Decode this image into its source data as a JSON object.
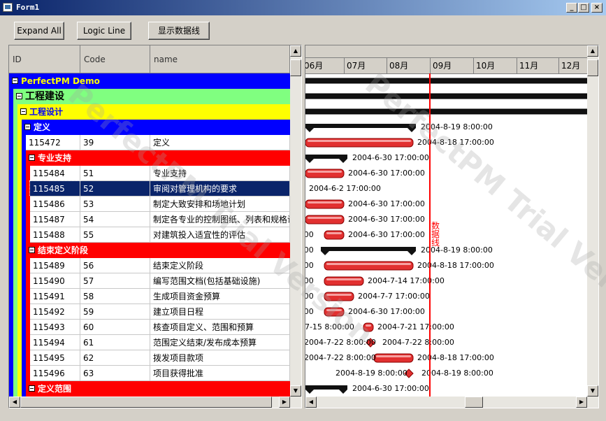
{
  "window": {
    "title": "Form1"
  },
  "toolbar": {
    "expand_all": "Expand All",
    "logic_line": "Logic Line",
    "show_data_line": "显示数据线"
  },
  "grid": {
    "headers": {
      "id": "ID",
      "code": "Code",
      "name": "name"
    },
    "rows": [
      {
        "type": "group",
        "level": 0,
        "label": "PerfectPM Demo",
        "bg": "#0000ff",
        "fg": "#ffff00"
      },
      {
        "type": "group",
        "level": 1,
        "label": "工程建设",
        "bg": "#80ff80",
        "fg": "#000000"
      },
      {
        "type": "group",
        "level": 2,
        "label": "工程设计",
        "bg": "#ffff00",
        "fg": "#0000ff"
      },
      {
        "type": "group",
        "level": 3,
        "label": "定义",
        "bg": "#0000ff",
        "fg": "#ffffff"
      },
      {
        "type": "task",
        "level": 4,
        "id": "115472",
        "code": "39",
        "name": "定义"
      },
      {
        "type": "group",
        "level": 4,
        "label": "专业支持",
        "bg": "#ff0000",
        "fg": "#ffffff"
      },
      {
        "type": "task",
        "level": 5,
        "id": "115484",
        "code": "51",
        "name": "专业支持"
      },
      {
        "type": "task",
        "level": 5,
        "id": "115485",
        "code": "52",
        "name": "审阅对管理机构的要求",
        "selected": true
      },
      {
        "type": "task",
        "level": 5,
        "id": "115486",
        "code": "53",
        "name": "制定大致安排和场地计划"
      },
      {
        "type": "task",
        "level": 5,
        "id": "115487",
        "code": "54",
        "name": "制定各专业的控制图纸、列表和规格说"
      },
      {
        "type": "task",
        "level": 5,
        "id": "115488",
        "code": "55",
        "name": "对建筑投入适宜性的评估"
      },
      {
        "type": "group",
        "level": 4,
        "label": "结束定义阶段",
        "bg": "#ff0000",
        "fg": "#ffffff"
      },
      {
        "type": "task",
        "level": 5,
        "id": "115489",
        "code": "56",
        "name": "结束定义阶段"
      },
      {
        "type": "task",
        "level": 5,
        "id": "115490",
        "code": "57",
        "name": "编写范围文档(包括基础设施)"
      },
      {
        "type": "task",
        "level": 5,
        "id": "115491",
        "code": "58",
        "name": "生成项目资金预算"
      },
      {
        "type": "task",
        "level": 5,
        "id": "115492",
        "code": "59",
        "name": "建立项目日程"
      },
      {
        "type": "task",
        "level": 5,
        "id": "115493",
        "code": "60",
        "name": "核查项目定义、范围和预算"
      },
      {
        "type": "task",
        "level": 5,
        "id": "115494",
        "code": "61",
        "name": "范围定义结束/发布成本预算"
      },
      {
        "type": "task",
        "level": 5,
        "id": "115495",
        "code": "62",
        "name": "拨发项目款项"
      },
      {
        "type": "task",
        "level": 5,
        "id": "115496",
        "code": "63",
        "name": "项目获得批准"
      },
      {
        "type": "group",
        "level": 4,
        "label": "定义范围",
        "bg": "#ff0000",
        "fg": "#ffffff"
      }
    ]
  },
  "gantt": {
    "months": [
      "06月",
      "07月",
      "08月",
      "09月",
      "10月",
      "11月",
      "12月"
    ],
    "data_line_label": "数据线",
    "data_line_color": "#ff0000",
    "bars": [
      {
        "kind": "full"
      },
      {
        "kind": "full"
      },
      {
        "kind": "full"
      },
      {
        "kind": "summary",
        "end": "2004-8-19 8:00:00"
      },
      {
        "kind": "task",
        "end": "2004-8-18 17:00:00"
      },
      {
        "kind": "summary",
        "end": "2004-6-30 17:00:00"
      },
      {
        "kind": "task",
        "end": "2004-6-30 17:00:00"
      },
      {
        "kind": "none",
        "end": "2004-6-2 17:00:00"
      },
      {
        "kind": "task",
        "end": "2004-6-30 17:00:00"
      },
      {
        "kind": "task",
        "end": "2004-6-30 17:00:00"
      },
      {
        "kind": "task",
        "start": ":00",
        "end": "2004-6-30 17:00:00"
      },
      {
        "kind": "summary",
        "start": ":00",
        "end": "2004-8-19 8:00:00"
      },
      {
        "kind": "task",
        "start": ":00",
        "end": "2004-8-18 17:00:00"
      },
      {
        "kind": "task",
        "start": ":00",
        "end": "2004-7-14 17:00:00"
      },
      {
        "kind": "task",
        "start": ":00",
        "end": "2004-7-7 17:00:00"
      },
      {
        "kind": "task",
        "start": ":00",
        "end": "2004-6-30 17:00:00"
      },
      {
        "kind": "task",
        "start": "-7-15 8:00:00",
        "end": "2004-7-21 17:00:00"
      },
      {
        "kind": "milestone",
        "start": "2004-7-22 8:00:00",
        "end": "2004-7-22 8:00:00"
      },
      {
        "kind": "task",
        "start": "2004-7-22 8:00:00",
        "end": "2004-8-18 17:00:00"
      },
      {
        "kind": "milestone",
        "start": "2004-8-19 8:00:00",
        "end": "2004-8-19 8:00:00"
      },
      {
        "kind": "summary",
        "end": "2004-6-30 17:00:00"
      }
    ]
  },
  "watermark": "PerfectPM Trial Version"
}
